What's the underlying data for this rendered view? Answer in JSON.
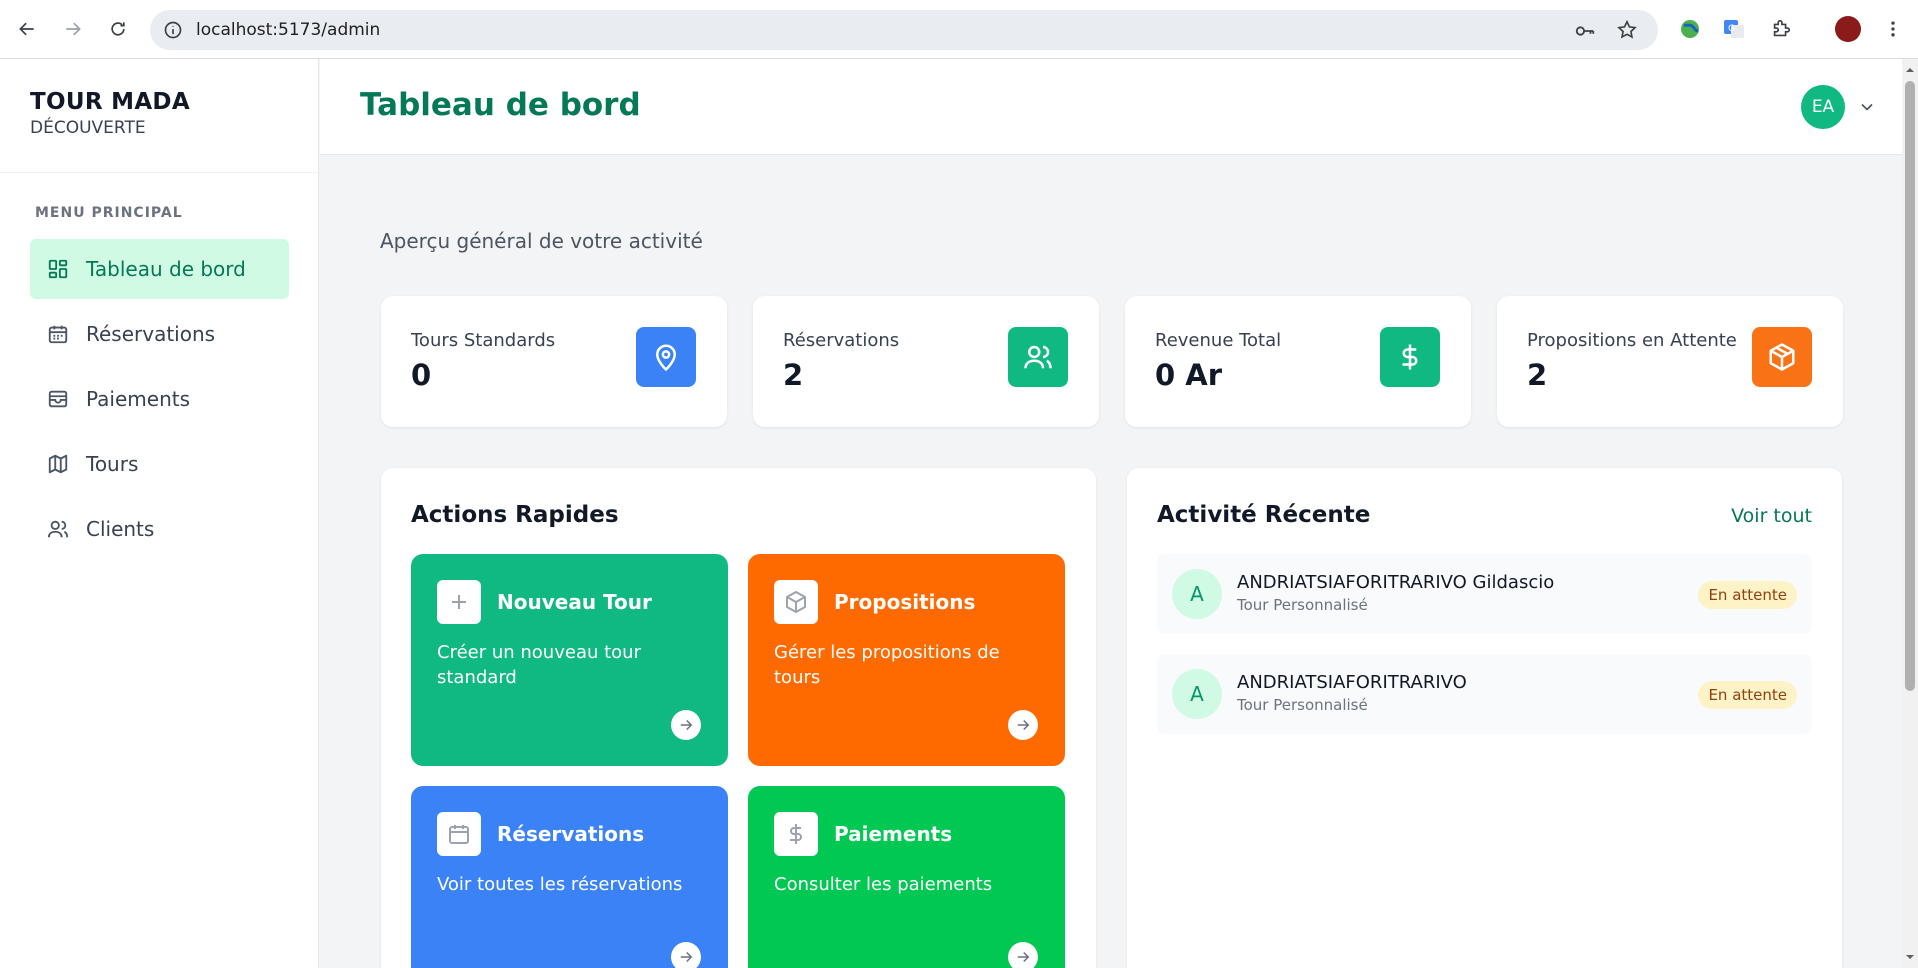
{
  "browser": {
    "url": "localhost:5173/admin"
  },
  "sidebar": {
    "brand_title": "TOUR MADA",
    "brand_sub": "DÉCOUVERTE",
    "menu_heading": "MENU PRINCIPAL",
    "items": [
      {
        "label": "Tableau de bord",
        "icon": "dashboard-icon",
        "active": true
      },
      {
        "label": "Réservations",
        "icon": "calendar-icon",
        "active": false
      },
      {
        "label": "Paiements",
        "icon": "wallet-icon",
        "active": false
      },
      {
        "label": "Tours",
        "icon": "map-icon",
        "active": false
      },
      {
        "label": "Clients",
        "icon": "users-icon",
        "active": false
      }
    ]
  },
  "header": {
    "title": "Tableau de bord",
    "avatar_initials": "EA"
  },
  "overview": {
    "subtitle": "Aperçu général de votre activité"
  },
  "stats": [
    {
      "label": "Tours Standards",
      "value": "0",
      "icon": "map-pin-icon",
      "color": "#3b82f6"
    },
    {
      "label": "Réservations",
      "value": "2",
      "icon": "users-icon",
      "color": "#10b981"
    },
    {
      "label": "Revenue Total",
      "value": "0 Ar",
      "icon": "dollar-icon",
      "color": "#10b981"
    },
    {
      "label": "Propositions en Attente",
      "value": "2",
      "icon": "box-icon",
      "color": "#f97316"
    }
  ],
  "quick_actions": {
    "title": "Actions Rapides",
    "items": [
      {
        "title": "Nouveau Tour",
        "desc": "Créer un nouveau tour standard",
        "icon": "plus-icon",
        "color": "#10b981"
      },
      {
        "title": "Propositions",
        "desc": "Gérer les propositions de tours",
        "icon": "box-icon",
        "color": "#ff6a00"
      },
      {
        "title": "Réservations",
        "desc": "Voir toutes les réservations",
        "icon": "calendar-icon",
        "color": "#3b82f6"
      },
      {
        "title": "Paiements",
        "desc": "Consulter les paiements",
        "icon": "dollar-icon",
        "color": "#00c853"
      }
    ]
  },
  "recent_activity": {
    "title": "Activité Récente",
    "see_all": "Voir tout",
    "items": [
      {
        "initial": "A",
        "name": "ANDRIATSIAFORITRARIVO Gildascio",
        "type": "Tour Personnalisé",
        "status": "En attente"
      },
      {
        "initial": "A",
        "name": "ANDRIATSIAFORITRARIVO",
        "type": "Tour Personnalisé",
        "status": "En attente"
      }
    ]
  }
}
